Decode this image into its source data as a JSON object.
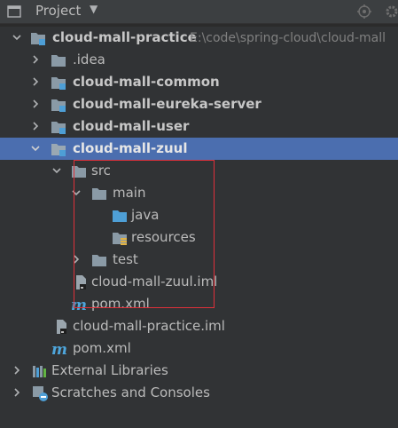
{
  "header": {
    "title": "Project",
    "caret": "▼"
  },
  "tree": {
    "root_label": "cloud-mall-practice",
    "root_path": "E:\\code\\spring-cloud\\cloud-mall",
    "idea": ".idea",
    "common": "cloud-mall-common",
    "eureka": "cloud-mall-eureka-server",
    "user": "cloud-mall-user",
    "zuul": "cloud-mall-zuul",
    "src": "src",
    "main": "main",
    "java": "java",
    "resources": "resources",
    "test": "test",
    "zuul_iml": "cloud-mall-zuul.iml",
    "zuul_pom": "pom.xml",
    "practice_iml": "cloud-mall-practice.iml",
    "root_pom": "pom.xml",
    "external_libraries": "External Libraries",
    "scratches": "Scratches and Consoles"
  },
  "colors": {
    "selection": "#4b6eaf",
    "folder": "#8a9aa6",
    "source_folder": "#4e9fd6",
    "highlight_box": "#e0303a",
    "maven": "#4ea6dc"
  }
}
